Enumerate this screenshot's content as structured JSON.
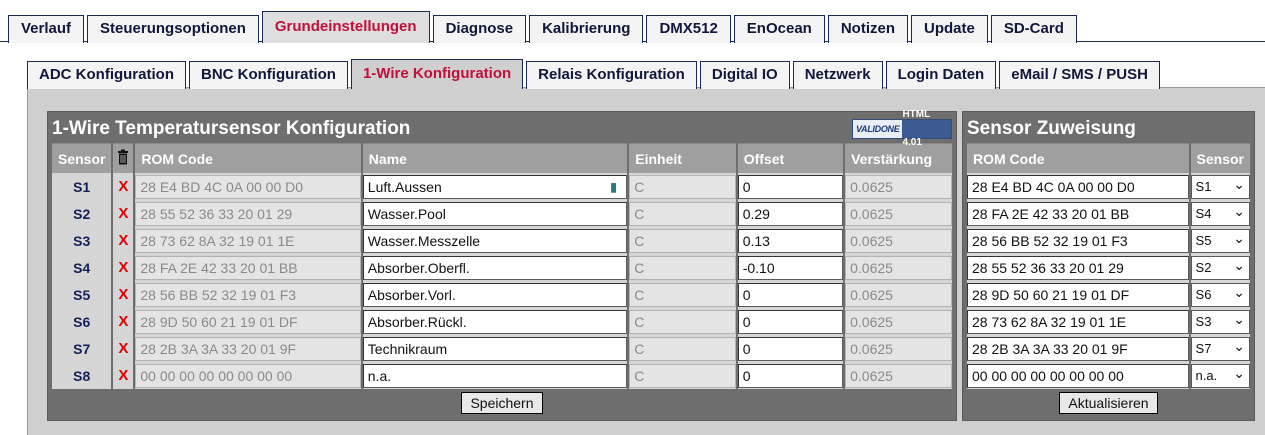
{
  "main_tabs": [
    "Verlauf",
    "Steuerungsoptionen",
    "Grundeinstellungen",
    "Diagnose",
    "Kalibrierung",
    "DMX512",
    "EnOcean",
    "Notizen",
    "Update",
    "SD-Card"
  ],
  "main_tab_active": 2,
  "sub_tabs": [
    "ADC Konfiguration",
    "BNC Konfiguration",
    "1-Wire Konfiguration",
    "Relais Konfiguration",
    "Digital IO",
    "Netzwerk",
    "Login Daten",
    "eMail / SMS / PUSH"
  ],
  "sub_tab_active": 2,
  "left": {
    "title": "1-Wire Temperatursensor Konfiguration",
    "badge_v": "VALIDONE",
    "badge_h": "HTML 4.01",
    "headers": {
      "sensor": "Sensor",
      "rom": "ROM Code",
      "name": "Name",
      "unit": "Einheit",
      "offset": "Offset",
      "gain": "Verstärkung"
    },
    "rows": [
      {
        "sensor": "S1",
        "del": "X",
        "rom": "28 E4 BD 4C 0A 00 00 D0",
        "name": "Luft.Aussen",
        "unit": "C",
        "offset": "0",
        "gain": "0.0625"
      },
      {
        "sensor": "S2",
        "del": "X",
        "rom": "28 55 52 36 33 20 01 29",
        "name": "Wasser.Pool",
        "unit": "C",
        "offset": "0.29",
        "gain": "0.0625"
      },
      {
        "sensor": "S3",
        "del": "X",
        "rom": "28 73 62 8A 32 19 01 1E",
        "name": "Wasser.Messzelle",
        "unit": "C",
        "offset": "0.13",
        "gain": "0.0625"
      },
      {
        "sensor": "S4",
        "del": "X",
        "rom": "28 FA 2E 42 33 20 01 BB",
        "name": "Absorber.Oberfl.",
        "unit": "C",
        "offset": "-0.10",
        "gain": "0.0625"
      },
      {
        "sensor": "S5",
        "del": "X",
        "rom": "28 56 BB 52 32 19 01 F3",
        "name": "Absorber.Vorl.",
        "unit": "C",
        "offset": "0",
        "gain": "0.0625"
      },
      {
        "sensor": "S6",
        "del": "X",
        "rom": "28 9D 50 60 21 19 01 DF",
        "name": "Absorber.Rückl.",
        "unit": "C",
        "offset": "0",
        "gain": "0.0625"
      },
      {
        "sensor": "S7",
        "del": "X",
        "rom": "28 2B 3A 3A 33 20 01 9F",
        "name": "Technikraum",
        "unit": "C",
        "offset": "0",
        "gain": "0.0625"
      },
      {
        "sensor": "S8",
        "del": "X",
        "rom": "00 00 00 00 00 00 00 00",
        "name": "n.a.",
        "unit": "C",
        "offset": "0",
        "gain": "0.0625"
      }
    ],
    "save_label": "Speichern"
  },
  "right": {
    "title": "Sensor Zuweisung",
    "headers": {
      "rom": "ROM Code",
      "sensor": "Sensor"
    },
    "rows": [
      {
        "rom": "28 E4 BD 4C 0A 00 00 D0",
        "sensor": "S1"
      },
      {
        "rom": "28 FA 2E 42 33 20 01 BB",
        "sensor": "S4"
      },
      {
        "rom": "28 56 BB 52 32 19 01 F3",
        "sensor": "S5"
      },
      {
        "rom": "28 55 52 36 33 20 01 29",
        "sensor": "S2"
      },
      {
        "rom": "28 9D 50 60 21 19 01 DF",
        "sensor": "S6"
      },
      {
        "rom": "28 73 62 8A 32 19 01 1E",
        "sensor": "S3"
      },
      {
        "rom": "28 2B 3A 3A 33 20 01 9F",
        "sensor": "S7"
      },
      {
        "rom": "00 00 00 00 00 00 00 00",
        "sensor": "n.a."
      }
    ],
    "update_label": "Aktualisieren"
  }
}
